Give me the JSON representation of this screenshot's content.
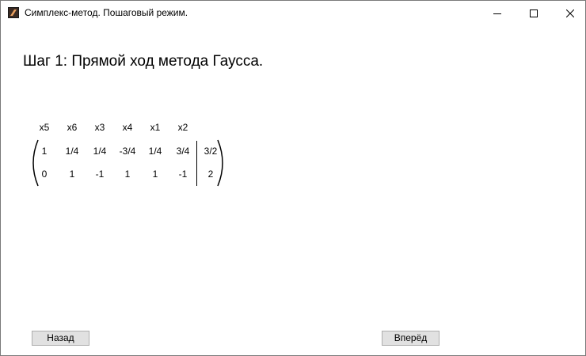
{
  "window": {
    "title": "Симплекс-метод. Пошаговый режим.",
    "app_icon": "app-icon",
    "controls": [
      "minimize-icon",
      "maximize-icon",
      "close-icon"
    ]
  },
  "step": {
    "title": "Шаг 1: Прямой ход метода Гаусса."
  },
  "matrix": {
    "headers": [
      "x5",
      "x6",
      "x3",
      "x4",
      "x1",
      "x2"
    ],
    "rows": [
      {
        "cells": [
          "1",
          "1/4",
          "1/4",
          "-3/4",
          "1/4",
          "3/4"
        ],
        "rhs": "3/2"
      },
      {
        "cells": [
          "0",
          "1",
          "-1",
          "1",
          "1",
          "-1"
        ],
        "rhs": "2"
      }
    ]
  },
  "buttons": {
    "back_label": "Назад",
    "forward_label": "Вперёд"
  }
}
